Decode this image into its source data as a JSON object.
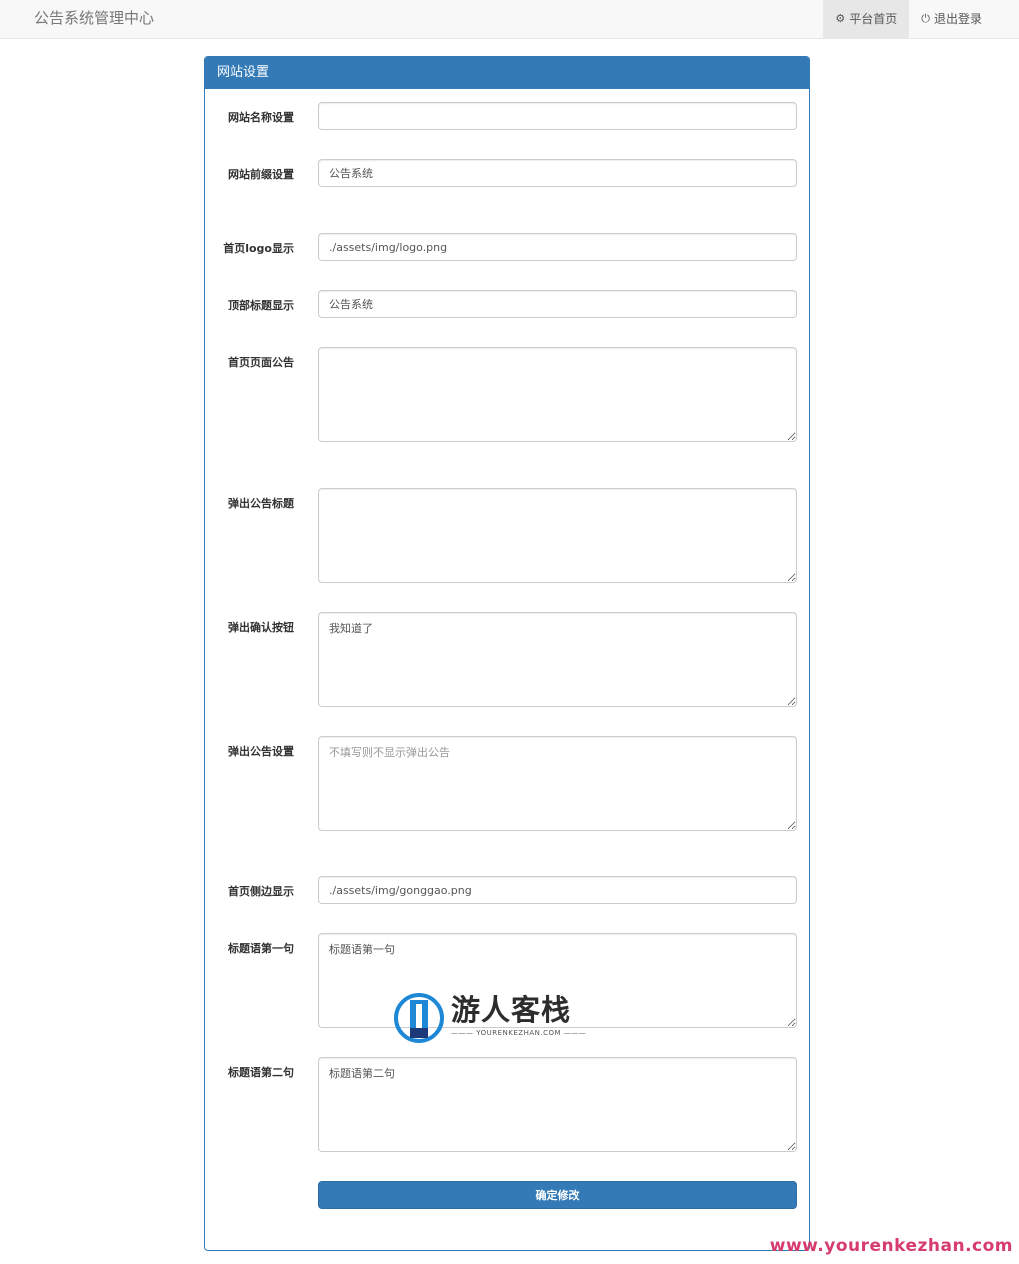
{
  "navbar": {
    "brand": "公告系统管理中心",
    "home_label": "平台首页",
    "logout_label": "退出登录"
  },
  "panel": {
    "title": "网站设置"
  },
  "form": {
    "site_name": {
      "label": "网站名称设置",
      "value": ""
    },
    "site_suffix": {
      "label": "网站前缀设置",
      "value": "公告系统"
    },
    "logo": {
      "label": "首页logo显示",
      "value": "./assets/img/logo.png"
    },
    "top_title": {
      "label": "顶部标题显示",
      "value": "公告系统"
    },
    "home_notice": {
      "label": "首页页面公告",
      "value": ""
    },
    "popup_title": {
      "label": "弹出公告标题",
      "value": ""
    },
    "popup_button": {
      "label": "弹出确认按钮",
      "value": "我知道了"
    },
    "popup_setting": {
      "label": "弹出公告设置",
      "value": "",
      "placeholder": "不填写则不显示弹出公告"
    },
    "side_image": {
      "label": "首页侧边显示",
      "value": "./assets/img/gonggao.png"
    },
    "slogan_1": {
      "label": "标题语第一句",
      "value": "标题语第一句"
    },
    "slogan_2": {
      "label": "标题语第二句",
      "value": "标题语第二句"
    },
    "submit_label": "确定修改"
  },
  "watermark": {
    "name": "游人客栈",
    "sub": "YOURENKEZHAN.COM",
    "url": "www.yourenkezhan.com"
  },
  "colors": {
    "primary": "#337ab7",
    "watermark_url": "#d63c6d"
  }
}
